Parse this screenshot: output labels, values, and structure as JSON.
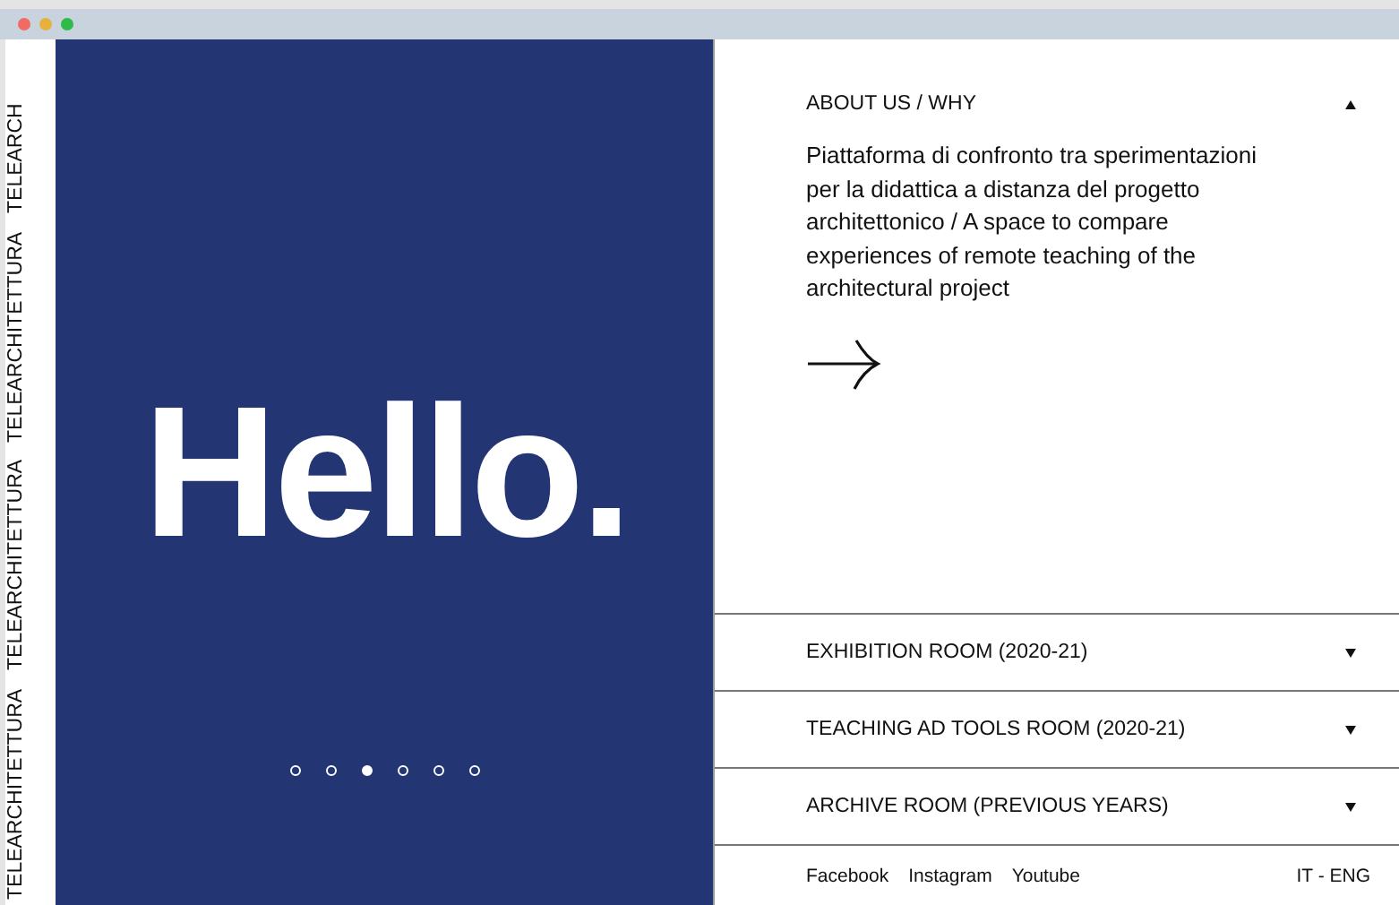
{
  "side_strip": {
    "texts": [
      "TELEARCHITETTURA",
      "TELEARCHITETTURA",
      "TELEARCHITETTURA",
      "TELEARCH"
    ]
  },
  "hero": {
    "title": "Hello.",
    "slides": [
      {
        "selected": false
      },
      {
        "selected": false
      },
      {
        "selected": true
      },
      {
        "selected": false
      },
      {
        "selected": false
      },
      {
        "selected": false
      }
    ]
  },
  "sections": [
    {
      "title": "ABOUT US / WHY",
      "expanded": true,
      "text": "Piattaforma di confronto tra sperimentazioni per la didattica a distanza del progetto architettonico / A space to compare experiences of remote teaching of the architectural project"
    },
    {
      "title": "EXHIBITION ROOM (2020-21)",
      "expanded": false
    },
    {
      "title": "TEACHING AD TOOLS ROOM (2020-21)",
      "expanded": false
    },
    {
      "title": "ARCHIVE ROOM (PREVIOUS YEARS)",
      "expanded": false
    }
  ],
  "footer": {
    "links": [
      "Facebook",
      "Instagram",
      "Youtube"
    ],
    "language": "IT - ENG"
  }
}
